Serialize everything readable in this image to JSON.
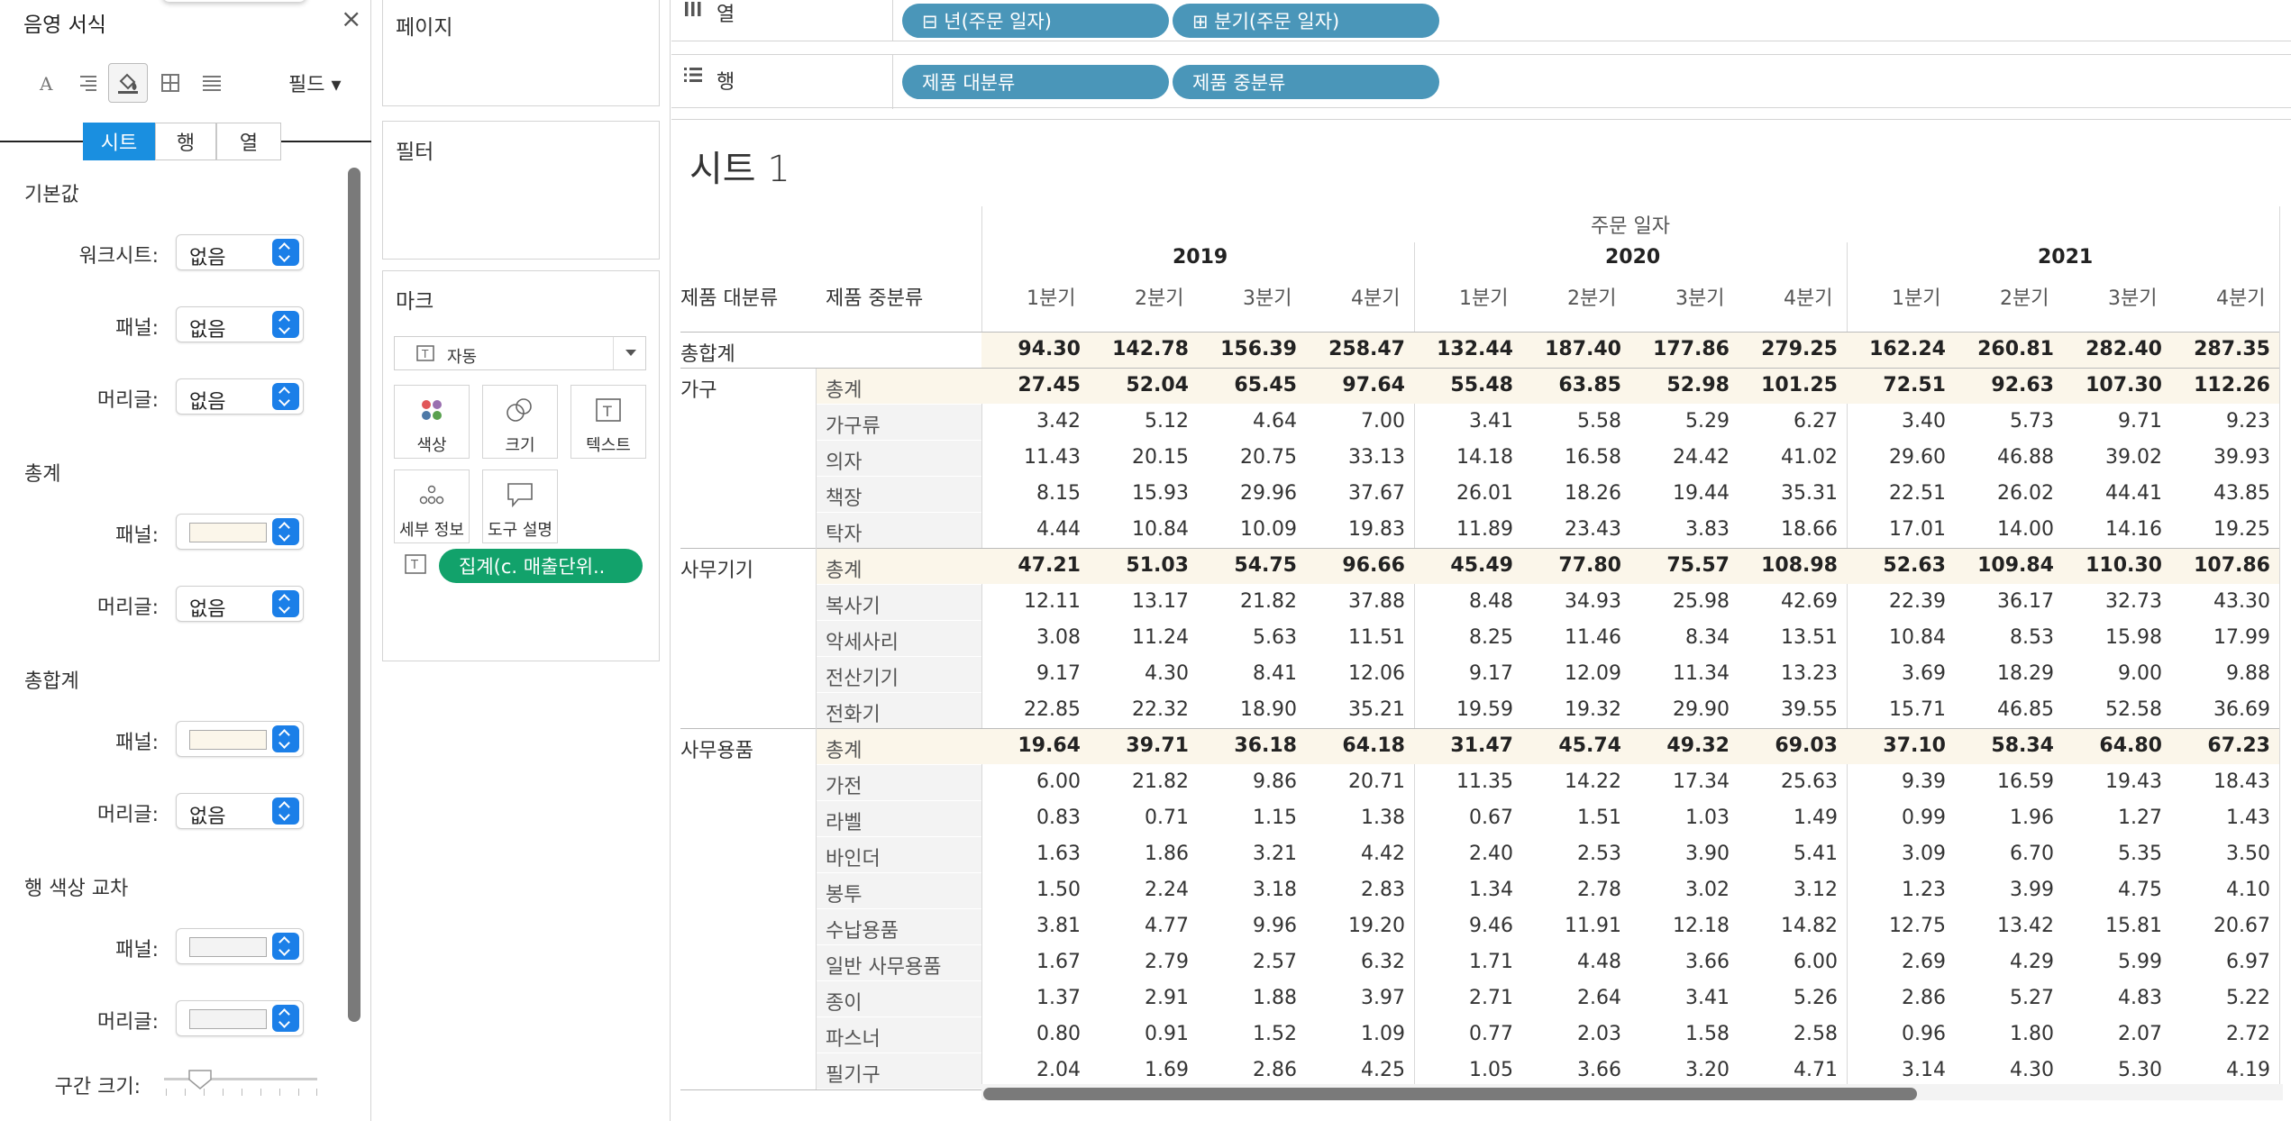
{
  "format_pane": {
    "title": "음영 서식",
    "close": "×",
    "field_dropdown": "필드 ▾",
    "tabs": [
      "시트",
      "행",
      "열"
    ],
    "sections": {
      "default": {
        "title": "기본값",
        "worksheet_label": "워크시트:",
        "worksheet_value": "없음",
        "panel_label": "패널:",
        "panel_value": "없음",
        "header_label": "머리글:",
        "header_value": "없음"
      },
      "totals": {
        "title": "총계",
        "panel_label": "패널:",
        "header_label": "머리글:",
        "header_value": "없음"
      },
      "grand_totals": {
        "title": "총합계",
        "panel_label": "패널:",
        "header_label": "머리글:",
        "header_value": "없음"
      },
      "row_banding": {
        "title": "행 색상 교차",
        "panel_label": "패널:",
        "header_label": "머리글:"
      },
      "band_size_label": "구간 크기:"
    },
    "colors": {
      "accent": "#1a8fe0",
      "total_swatch": "#fbf6ea",
      "band_swatch": "#f3f3f3"
    }
  },
  "cards": {
    "pages": "페이지",
    "filters": "필터",
    "marks": {
      "title": "마크",
      "type": "자동",
      "buttons": [
        "색상",
        "크기",
        "텍스트",
        "세부 정보",
        "도구 설명"
      ],
      "pill": "집계(c. 매출단위.."
    }
  },
  "shelves": {
    "columns_label": "열",
    "rows_label": "행",
    "columns": [
      "⊟ 년(주문 일자)",
      "⊞ 분기(주문 일자)"
    ],
    "rows": [
      "제품 대분류",
      "제품 중분류"
    ]
  },
  "sheet": {
    "title": "시트 1",
    "date_header": "주문 일자",
    "row_header_1": "제품 대분류",
    "row_header_2": "제품 중분류",
    "years": [
      "2019",
      "2020",
      "2021"
    ],
    "quarters": [
      "1분기",
      "2분기",
      "3분기",
      "4분기"
    ],
    "rows": [
      {
        "cat": "총합계",
        "sub": "",
        "type": "grand",
        "values": [
          "94.30",
          "142.78",
          "156.39",
          "258.47",
          "132.44",
          "187.40",
          "177.86",
          "279.25",
          "162.24",
          "260.81",
          "282.40",
          "287.35"
        ]
      },
      {
        "cat": "가구",
        "sub": "총계",
        "type": "total",
        "values": [
          "27.45",
          "52.04",
          "65.45",
          "97.64",
          "55.48",
          "63.85",
          "52.98",
          "101.25",
          "72.51",
          "92.63",
          "107.30",
          "112.26"
        ]
      },
      {
        "cat": "",
        "sub": "가구류",
        "type": "row",
        "values": [
          "3.42",
          "5.12",
          "4.64",
          "7.00",
          "3.41",
          "5.58",
          "5.29",
          "6.27",
          "3.40",
          "5.73",
          "9.71",
          "9.23"
        ]
      },
      {
        "cat": "",
        "sub": "의자",
        "type": "row",
        "values": [
          "11.43",
          "20.15",
          "20.75",
          "33.13",
          "14.18",
          "16.58",
          "24.42",
          "41.02",
          "29.60",
          "46.88",
          "39.02",
          "39.93"
        ]
      },
      {
        "cat": "",
        "sub": "책장",
        "type": "row",
        "values": [
          "8.15",
          "15.93",
          "29.96",
          "37.67",
          "26.01",
          "18.26",
          "19.44",
          "35.31",
          "22.51",
          "26.02",
          "44.41",
          "43.85"
        ]
      },
      {
        "cat": "",
        "sub": "탁자",
        "type": "row",
        "values": [
          "4.44",
          "10.84",
          "10.09",
          "19.83",
          "11.89",
          "23.43",
          "3.83",
          "18.66",
          "17.01",
          "14.00",
          "14.16",
          "19.25"
        ]
      },
      {
        "cat": "사무기기",
        "sub": "총계",
        "type": "total",
        "values": [
          "47.21",
          "51.03",
          "54.75",
          "96.66",
          "45.49",
          "77.80",
          "75.57",
          "108.98",
          "52.63",
          "109.84",
          "110.30",
          "107.86"
        ]
      },
      {
        "cat": "",
        "sub": "복사기",
        "type": "row",
        "values": [
          "12.11",
          "13.17",
          "21.82",
          "37.88",
          "8.48",
          "34.93",
          "25.98",
          "42.69",
          "22.39",
          "36.17",
          "32.73",
          "43.30"
        ]
      },
      {
        "cat": "",
        "sub": "악세사리",
        "type": "row",
        "values": [
          "3.08",
          "11.24",
          "5.63",
          "11.51",
          "8.25",
          "11.46",
          "8.34",
          "13.51",
          "10.84",
          "8.53",
          "15.98",
          "17.99"
        ]
      },
      {
        "cat": "",
        "sub": "전산기기",
        "type": "row",
        "values": [
          "9.17",
          "4.30",
          "8.41",
          "12.06",
          "9.17",
          "12.09",
          "11.34",
          "13.23",
          "3.69",
          "18.29",
          "9.00",
          "9.88"
        ]
      },
      {
        "cat": "",
        "sub": "전화기",
        "type": "row",
        "values": [
          "22.85",
          "22.32",
          "18.90",
          "35.21",
          "19.59",
          "19.32",
          "29.90",
          "39.55",
          "15.71",
          "46.85",
          "52.58",
          "36.69"
        ]
      },
      {
        "cat": "사무용품",
        "sub": "총계",
        "type": "total",
        "values": [
          "19.64",
          "39.71",
          "36.18",
          "64.18",
          "31.47",
          "45.74",
          "49.32",
          "69.03",
          "37.10",
          "58.34",
          "64.80",
          "67.23"
        ]
      },
      {
        "cat": "",
        "sub": "가전",
        "type": "row",
        "values": [
          "6.00",
          "21.82",
          "9.86",
          "20.71",
          "11.35",
          "14.22",
          "17.34",
          "25.63",
          "9.39",
          "16.59",
          "19.43",
          "18.43"
        ]
      },
      {
        "cat": "",
        "sub": "라벨",
        "type": "row",
        "values": [
          "0.83",
          "0.71",
          "1.15",
          "1.38",
          "0.67",
          "1.51",
          "1.03",
          "1.49",
          "0.99",
          "1.96",
          "1.27",
          "1.43"
        ]
      },
      {
        "cat": "",
        "sub": "바인더",
        "type": "row",
        "values": [
          "1.63",
          "1.86",
          "3.21",
          "4.42",
          "2.40",
          "2.53",
          "3.90",
          "5.41",
          "3.09",
          "6.70",
          "5.35",
          "3.50"
        ]
      },
      {
        "cat": "",
        "sub": "봉투",
        "type": "row",
        "values": [
          "1.50",
          "2.24",
          "3.18",
          "2.83",
          "1.34",
          "2.78",
          "3.02",
          "3.12",
          "1.23",
          "3.99",
          "4.75",
          "4.10"
        ]
      },
      {
        "cat": "",
        "sub": "수납용품",
        "type": "row",
        "values": [
          "3.81",
          "4.77",
          "9.96",
          "19.20",
          "9.46",
          "11.91",
          "12.18",
          "14.82",
          "12.75",
          "13.42",
          "15.81",
          "20.67"
        ]
      },
      {
        "cat": "",
        "sub": "일반 사무용품",
        "type": "row",
        "values": [
          "1.67",
          "2.79",
          "2.57",
          "6.32",
          "1.71",
          "4.48",
          "3.66",
          "6.00",
          "2.69",
          "4.29",
          "5.99",
          "6.97"
        ]
      },
      {
        "cat": "",
        "sub": "종이",
        "type": "row",
        "values": [
          "1.37",
          "2.91",
          "1.88",
          "3.97",
          "2.71",
          "2.64",
          "3.41",
          "5.26",
          "2.86",
          "5.27",
          "4.83",
          "5.22"
        ]
      },
      {
        "cat": "",
        "sub": "파스너",
        "type": "row",
        "values": [
          "0.80",
          "0.91",
          "1.52",
          "1.09",
          "0.77",
          "2.03",
          "1.58",
          "2.58",
          "0.96",
          "1.80",
          "2.07",
          "2.72"
        ]
      },
      {
        "cat": "",
        "sub": "필기구",
        "type": "row",
        "values": [
          "2.04",
          "1.69",
          "2.86",
          "4.25",
          "1.05",
          "3.66",
          "3.20",
          "4.71",
          "3.14",
          "4.30",
          "5.30",
          "4.19"
        ]
      }
    ],
    "colors": {
      "total_fill": "#fbf6ea",
      "band_fill": "#f3f3f3"
    }
  }
}
